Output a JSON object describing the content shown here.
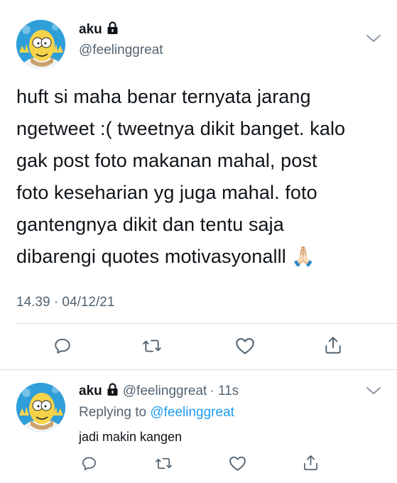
{
  "main_tweet": {
    "author": {
      "name": "aku",
      "handle": "@feelinggreat",
      "avatar": "homer-avatar",
      "locked": true
    },
    "text_lines": [
      "huft si maha benar ternyata jarang",
      "ngetweet :( tweetnya dikit banget. kalo",
      "gak post foto makanan mahal, post",
      "foto keseharian yg juga mahal. foto",
      "gantengnya dikit dan tentu saja",
      "dibarengi quotes motivasyonalll 🙏🏻"
    ],
    "timestamp": "14.39 · 04/12/21",
    "actions": [
      "reply-icon",
      "retweet-icon",
      "like-icon",
      "share-icon"
    ]
  },
  "reply_tweet": {
    "author": {
      "name": "aku",
      "handle": "@feelinggreat",
      "time": "· 11s",
      "avatar": "homer-avatar",
      "locked": true
    },
    "replying_label": "Replying to",
    "replying_to": "@feelinggreat",
    "text": "jadi makin kangen",
    "actions": [
      "reply-icon",
      "retweet-icon",
      "like-icon",
      "share-icon"
    ]
  },
  "colors": {
    "text": "#0f1419",
    "secondary": "#536471",
    "link": "#1d9bf0",
    "avatar_bg": "#2f9fd9",
    "divider": "#d6dde3"
  }
}
